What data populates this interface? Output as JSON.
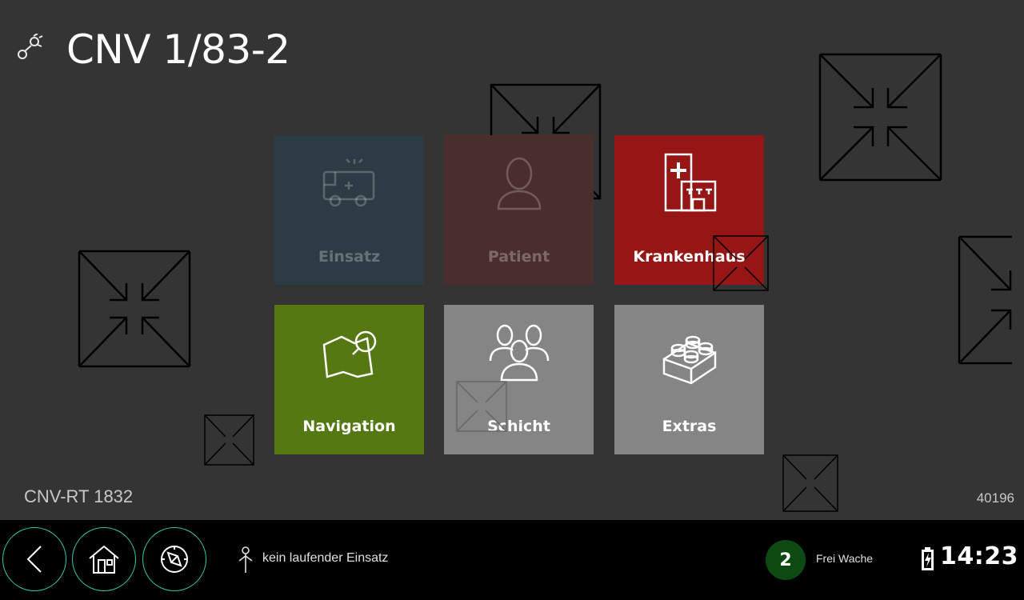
{
  "header": {
    "title": "CNV 1/83-2",
    "icon": "connection-icon"
  },
  "tiles": [
    {
      "label": "Einsatz",
      "icon": "ambulance-icon",
      "color": "#2d3c44",
      "enabled": false
    },
    {
      "label": "Patient",
      "icon": "patient-icon",
      "color": "#4a2e2e",
      "enabled": false
    },
    {
      "label": "Krankenhaus",
      "icon": "hospital-icon",
      "color": "#961515",
      "enabled": true
    },
    {
      "label": "Navigation",
      "icon": "map-search-icon",
      "color": "#557812",
      "enabled": true
    },
    {
      "label": "Schicht",
      "icon": "team-icon",
      "color": "#858585",
      "enabled": true
    },
    {
      "label": "Extras",
      "icon": "puzzle-brick-icon",
      "color": "#858585",
      "enabled": true
    }
  ],
  "footer": {
    "vehicle_id": "CNV-RT 1832",
    "device_code": "40196"
  },
  "bottom_bar": {
    "buttons": [
      {
        "name": "back",
        "icon": "chevron-left-icon"
      },
      {
        "name": "home",
        "icon": "home-icon"
      },
      {
        "name": "compass",
        "icon": "compass-icon"
      }
    ],
    "accent_color": "#33c7a6",
    "mission_status": "kein laufender Einsatz",
    "status_number": "2",
    "status_number_color": "#0d4a12",
    "status_label": "Frei Wache",
    "time": "14:23"
  }
}
